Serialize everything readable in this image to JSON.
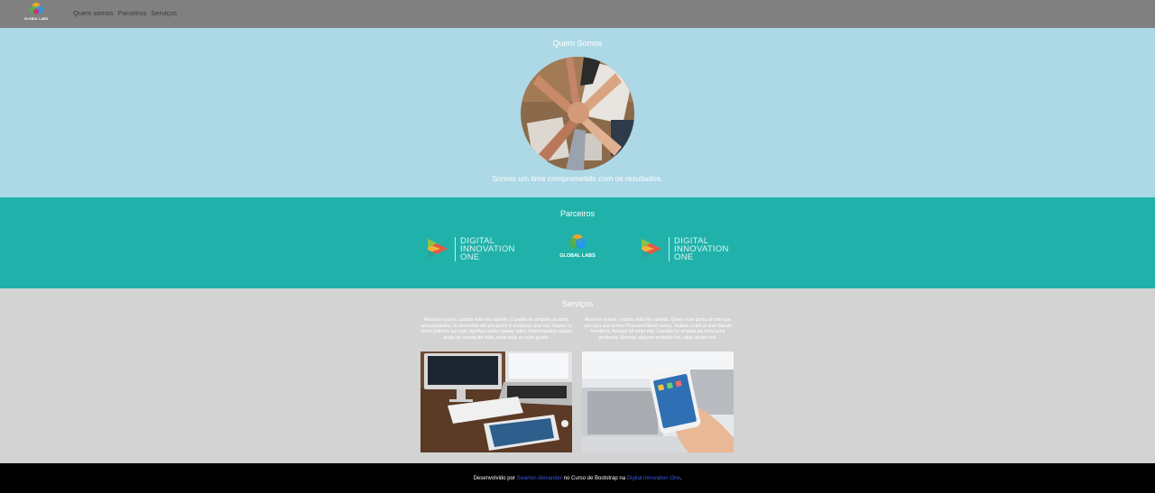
{
  "nav": {
    "logo_text": "GLOBAL LABS",
    "links": [
      "Quem somos",
      "Parceiros",
      "Serviços"
    ]
  },
  "about": {
    "title": "Quem Somos",
    "text": "Somos um time comprometido com os resultados."
  },
  "partners": {
    "title": "Parceiros",
    "dio_lines": [
      "DIGITAL",
      "INNOVATION",
      "ONE"
    ],
    "globallabs_text": "GLOBAL LABS"
  },
  "services": {
    "title": "Serviços",
    "items": [
      {
        "text": "Museum Ipsum, cacilds vidis litro abertis. Casadis im ampola pa arma uma pindureta. In elementis mé pra quem é amistosis quis leo. Sapien in monti palavris qui num significa nadis i pareci latim. Interessantiss quisso pudia ce receita de bolis, mais bolis eu num gostis."
      },
      {
        "text": "Museum Ipsum, cacilds vidis litro abertis. Quem num gosta di mim que vai caçá sua turmis! Praesent libero varius. Nullam a nisl ut ante blandit hendrerit. Aenean sit amet nisi. Casadis im ampola pa arma uma pindureta. Aenean aliquam molestie leo, vitae iaculis nisl."
      }
    ]
  },
  "footer": {
    "prefix": "Desenvolvido por ",
    "author": "Swarton Alexander",
    "middle": " no Curso de Bootstrap na ",
    "org": "Digital Innovation One",
    "suffix": "."
  },
  "colors": {
    "navbar": "#808080",
    "about_bg": "#add8e6",
    "partners_bg": "#20b2aa",
    "services_bg": "#d3d3d3",
    "footer_bg": "#000000",
    "link": "#3b5bdb"
  }
}
